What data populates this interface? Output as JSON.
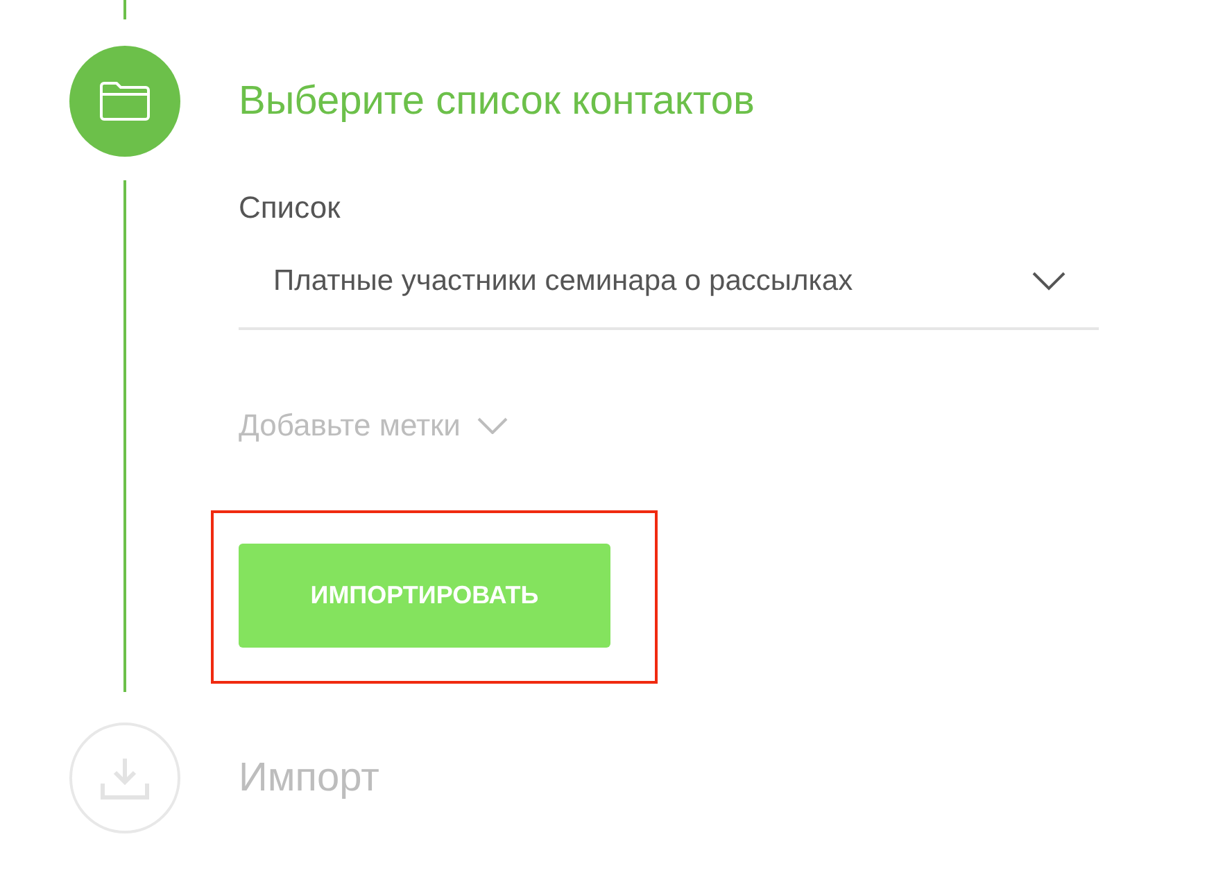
{
  "steps": [
    {
      "kind": "contacts",
      "title": "Выберите список контактов",
      "active": true
    },
    {
      "kind": "import",
      "title": "Импорт",
      "active": false
    }
  ],
  "list_field": {
    "label": "Список",
    "value": "Платные участники семинара о рассылках"
  },
  "tags_field": {
    "placeholder": "Добавьте метки"
  },
  "import_button": {
    "label": "ИМПОРТИРОВАТЬ",
    "highlighted": true
  }
}
